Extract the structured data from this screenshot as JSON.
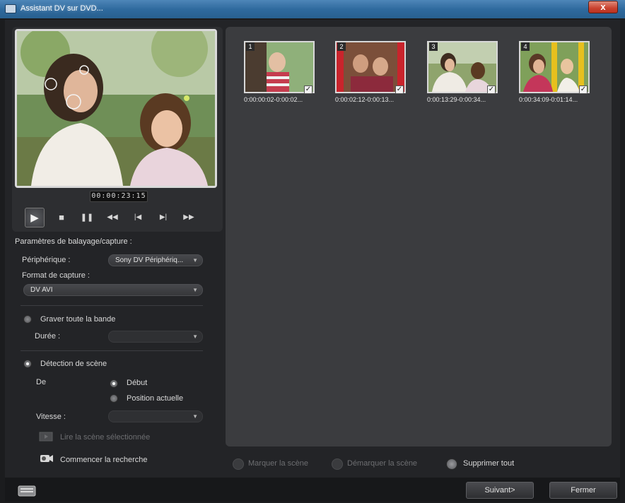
{
  "window": {
    "title": "Assistant DV sur DVD...",
    "close_label": "x"
  },
  "preview": {
    "timecode": "00:00:23:15",
    "transport": [
      {
        "name": "play-button",
        "glyph": "▶"
      },
      {
        "name": "stop-button",
        "glyph": "■"
      },
      {
        "name": "pause-button",
        "glyph": "❚❚"
      },
      {
        "name": "rewind-button",
        "glyph": "◀◀"
      },
      {
        "name": "previous-button",
        "glyph": "|◀"
      },
      {
        "name": "next-button",
        "glyph": "▶|"
      },
      {
        "name": "fast-forward-button",
        "glyph": "▶▶"
      }
    ]
  },
  "settings": {
    "section_title": "Paramètres de balayage/capture :",
    "device_label": "Périphérique :",
    "device_value": "Sony DV Périphériq...",
    "format_label": "Format de capture :",
    "format_value": "DV AVI",
    "burn_tape_label": "Graver toute la bande",
    "duration_label": "Durée :",
    "duration_value": "",
    "scene_detect_label": "Détection de scène",
    "from_label": "De",
    "start_label": "Début",
    "current_position_label": "Position actuelle",
    "speed_label": "Vitesse :",
    "speed_value": "",
    "play_selected_label": "Lire la scène sélectionnée",
    "start_search_label": "Commencer la recherche",
    "mode_selected": "scene_detection",
    "from_selected": "start"
  },
  "scenes": [
    {
      "number": "1",
      "time": "0:00:00:02-0:00:02...",
      "checked": true
    },
    {
      "number": "2",
      "time": "0:00:02:12-0:00:13...",
      "checked": true
    },
    {
      "number": "3",
      "time": "0:00:13:29-0:00:34...",
      "checked": true
    },
    {
      "number": "4",
      "time": "0:00:34:09-0:01:14...",
      "checked": true
    }
  ],
  "scene_actions": {
    "mark_label": "Marquer la scène",
    "unmark_label": "Démarquer la scène",
    "delete_all_label": "Supprimer tout"
  },
  "footer": {
    "next_label": "Suivant>",
    "close_label": "Fermer"
  }
}
